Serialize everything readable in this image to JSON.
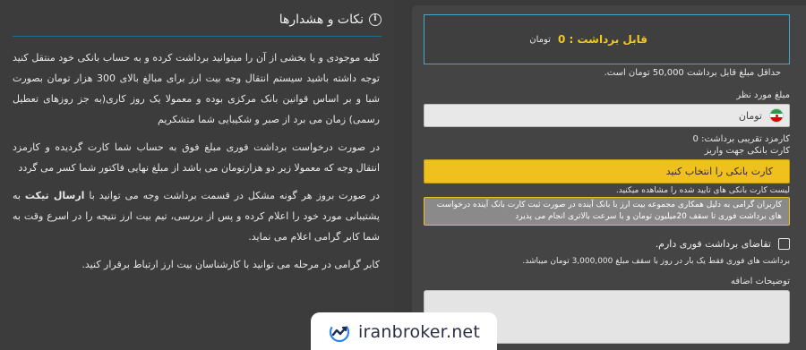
{
  "notes": {
    "title": "نکات و هشدارها",
    "icon": "info-icon",
    "paragraphs": [
      "کلیه موجودی و یا بخشی از آن را میتوانید برداشت کرده و به حساب بانکی خود منتقل کنید توجه داشته باشید سیستم انتقال وجه بیت ارز برای مبالغ بالای 300 هزار تومان بصورت شبا و بر اساس قوانین بانک مرکزی بوده و معمولا یک روز کاری(به جز روزهای تعطیل رسمی) زمان می برد از صبر و شکیبایی شما متشکریم",
      "در صورت درخواست برداشت فوری مبلغ فوق به حساب شما کارت گردیده و کارمزد انتقال وجه که معمولا زیر دو هزارتومان می باشد از مبلغ نهایی فاکتور شما کسر می گردد",
      "در صورت بروز هر گونه مشکل در قسمت برداشت وجه می توانید با",
      "کابر گرامی در مرحله می توانید با کارشناسان بیت ارز ارتباط برقرار کنید."
    ],
    "ticket_para_bold": "ارسال تیکت",
    "ticket_para_rest": "به پشتیبانی مورد خود را اعلام کرده و پس از بررسی، تیم بیت ارز نتیجه را در اسرع وقت به شما کابر گرامی اعلام می نماید."
  },
  "form": {
    "balance_label": "قابل برداشت : 0",
    "balance_unit": "تومان",
    "min_note": "حداقل مبلغ قابل برداشت 50,000 تومان است.",
    "currency_label": "مبلغ مورد نظر",
    "currency_value": "تومان",
    "currency_icon": "iran-flag-icon",
    "fee_line": "کارمزد تقریبی برداشت: 0",
    "card_label": "کارت بانکی جهت واریز",
    "card_select_placeholder": "کارت بانکی را انتخاب کنید",
    "card_note": "لیست کارت بانکی های تایید شده را مشاهده میکنید.",
    "warning_text": "کاربران گرامی به دلیل همکاری مجموعه بیت ارز با بانک آینده در صورت ثبت کارت بانک آینده درخواست های برداشت فوری تا سقف 20میلیون تومان و با سرعت بالاتری انجام می پذیرد",
    "instant_label": "تقاضای برداشت فوری دارم.",
    "instant_checked": false,
    "instant_note": "برداشت های فوری فقط یک بار در روز با سقف مبلغ 3,000,000 تومان میباشد.",
    "description_label": "توضیحات اضافه",
    "description_value": ""
  },
  "watermark": {
    "text": "iranbroker.net",
    "icon": "trend-logo-icon"
  },
  "colors": {
    "accent_yellow": "#f0c11e",
    "border_blue": "#4aa6c8",
    "panel_dark": "#3c3c3c"
  }
}
